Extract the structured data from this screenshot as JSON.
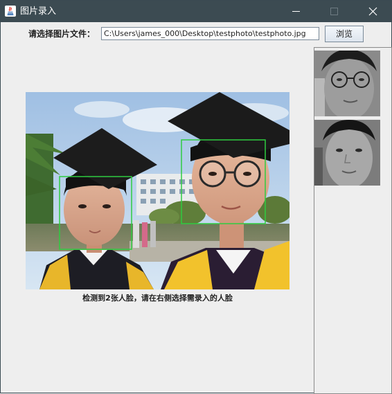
{
  "window": {
    "title": "图片录入",
    "controls": {
      "minimize": "minimize",
      "maximize": "maximize",
      "close": "close"
    },
    "colors": {
      "titlebar": "#3c4b52",
      "background": "#eeeeee"
    }
  },
  "file_select": {
    "label": "请选择图片文件：",
    "path_value": "C:\\Users\\james_000\\Desktop\\testphoto\\testphoto.jpg",
    "browse_label": "浏览"
  },
  "preview": {
    "image": "graduation selfie photo",
    "face_box_color": "#2ecc40",
    "caption": "检测到2张人脸，请在右侧选择需录入的人脸"
  },
  "faces": [
    {
      "name": "face-thumbnail-1"
    },
    {
      "name": "face-thumbnail-2"
    }
  ]
}
